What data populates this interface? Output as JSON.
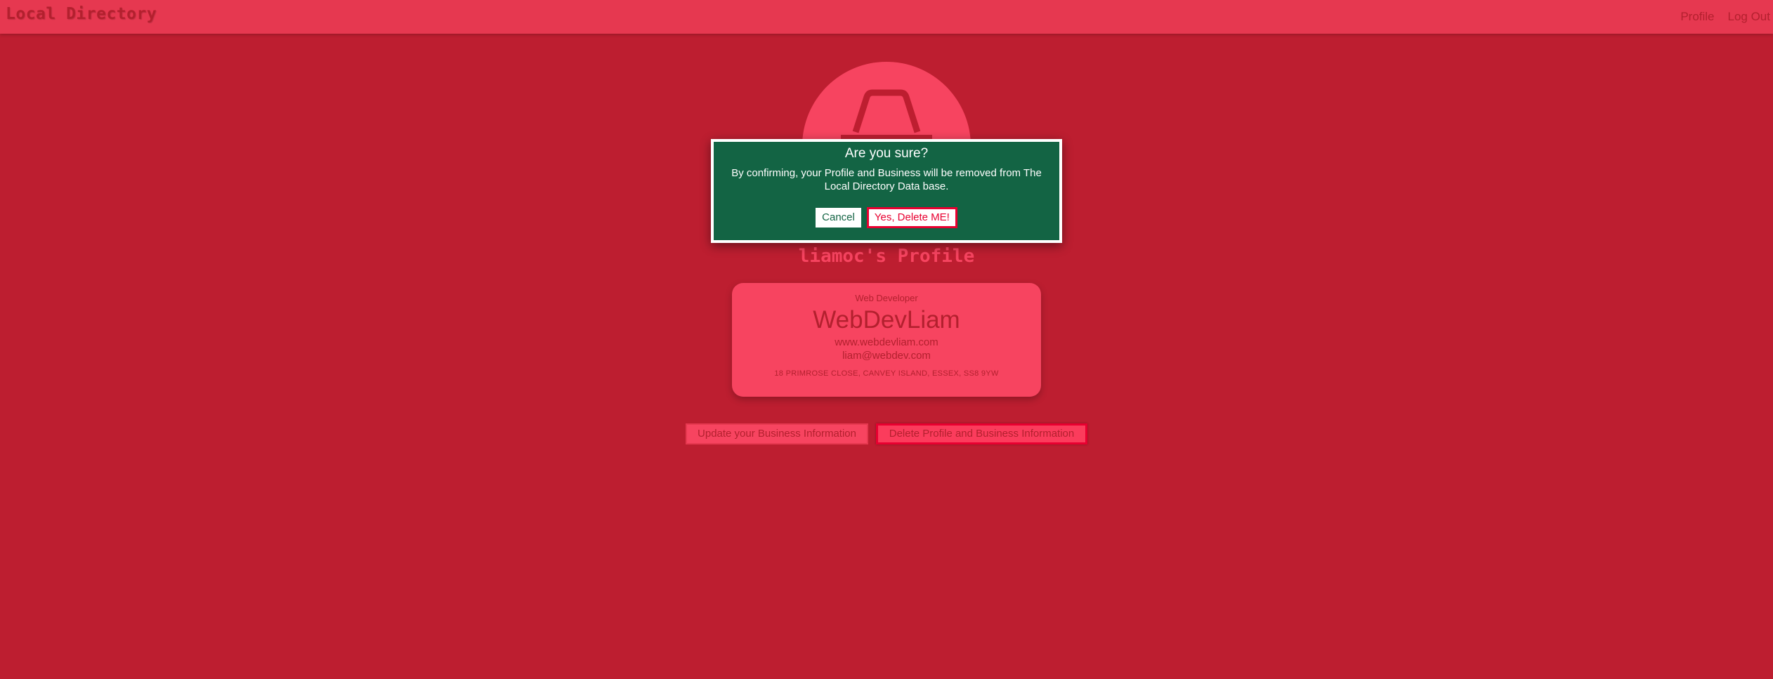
{
  "navbar": {
    "brand": "Local Directory",
    "links": [
      "Profile",
      "Log Out"
    ]
  },
  "avatar": {
    "icon": "user-silhouette-icon"
  },
  "profile": {
    "title": "liamoc's Profile"
  },
  "card": {
    "job": "Web Developer",
    "name": "WebDevLiam",
    "website": "www.webdevliam.com",
    "email": "liam@webdev.com",
    "address": "18 PRIMROSE CLOSE, CANVEY ISLAND, ESSEX, SS8 9YW"
  },
  "actions": {
    "update_label": "Update your Business Information",
    "delete_label": "Delete Profile and Business Information"
  },
  "modal": {
    "title": "Are you sure?",
    "message": "By confirming, your Profile and Business will be removed from The Local Directory Data base.",
    "cancel_label": "Cancel",
    "confirm_label": "Yes, Delete ME!"
  },
  "colors": {
    "background": "#bd1e30",
    "navbar": "#e63850",
    "accent_pink": "#f74460",
    "modal_green": "#136444",
    "danger_red": "#e80030"
  }
}
